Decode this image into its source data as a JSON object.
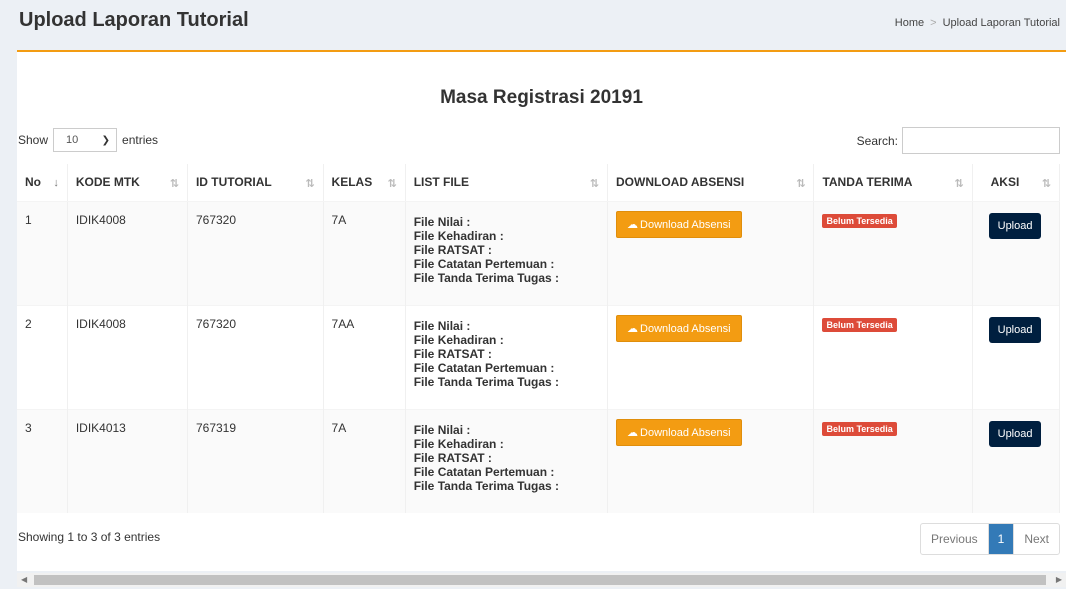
{
  "header": {
    "title": "Upload Laporan Tutorial",
    "breadcrumb": [
      "Home",
      "Upload Laporan Tutorial"
    ]
  },
  "box": {
    "title": "Masa Registrasi 20191"
  },
  "controls": {
    "show_label": "Show",
    "entries_value": "10",
    "entries_label": "entries",
    "search_label": "Search:",
    "search_value": ""
  },
  "table": {
    "columns": [
      "No",
      "KODE MTK",
      "ID TUTORIAL",
      "KELAS",
      "LIST FILE",
      "DOWNLOAD ABSENSI",
      "TANDA TERIMA",
      "AKSI"
    ],
    "rows": [
      {
        "no": "1",
        "kode": "IDIK4008",
        "id": "767320",
        "kelas": "7A",
        "files": [
          "File Nilai :",
          "File Kehadiran :",
          "File RATSAT :",
          "File Catatan Pertemuan :",
          "File Tanda Terima Tugas :"
        ],
        "download": "Download Absensi",
        "tanda": "Belum Tersedia",
        "aksi": "Upload"
      },
      {
        "no": "2",
        "kode": "IDIK4008",
        "id": "767320",
        "kelas": "7AA",
        "files": [
          "File Nilai :",
          "File Kehadiran :",
          "File RATSAT :",
          "File Catatan Pertemuan :",
          "File Tanda Terima Tugas :"
        ],
        "download": "Download Absensi",
        "tanda": "Belum Tersedia",
        "aksi": "Upload"
      },
      {
        "no": "3",
        "kode": "IDIK4013",
        "id": "767319",
        "kelas": "7A",
        "files": [
          "File Nilai :",
          "File Kehadiran :",
          "File RATSAT :",
          "File Catatan Pertemuan :",
          "File Tanda Terima Tugas :"
        ],
        "download": "Download Absensi",
        "tanda": "Belum Tersedia",
        "aksi": "Upload"
      }
    ]
  },
  "footer": {
    "info": "Showing 1 to 3 of 3 entries",
    "prev": "Previous",
    "page": "1",
    "next": "Next"
  },
  "colors": {
    "accent": "#f39c12",
    "badge": "#dd4b39",
    "upload": "#001f3f",
    "page_active": "#337ab7"
  },
  "icons": {
    "download": "cloud-download-icon",
    "sort": "sort-icon",
    "select": "chevron-down-icon"
  }
}
